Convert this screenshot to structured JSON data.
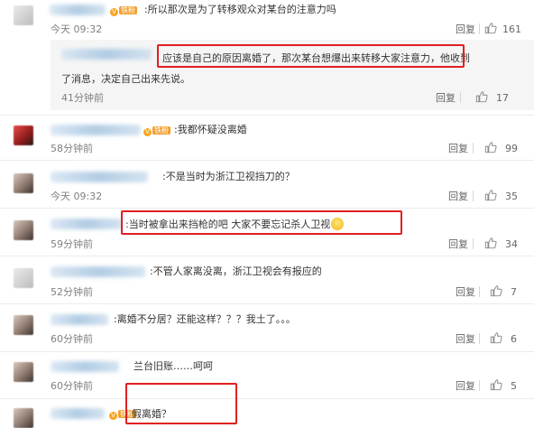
{
  "comments": [
    {
      "text": ":所以那次是为了转移观众对某台的注意力吗",
      "time": "今天 09:32",
      "reply": "回复",
      "likes": "161",
      "badge": "铁粉"
    },
    {
      "text_line1": "应该是自己的原因离婚了，那次某台想爆出来转移大家注意力，他收到",
      "text_line2": "了消息，决定自己出来先说。",
      "time": "41分钟前",
      "reply": "回复",
      "likes": "17"
    },
    {
      "text": ":我都怀疑没离婚",
      "time": "58分钟前",
      "reply": "回复",
      "likes": "99",
      "badge": "铁粉"
    },
    {
      "text": ":不是当时为浙江卫视挡刀的？",
      "time": "今天 09:32",
      "reply": "回复",
      "likes": "35"
    },
    {
      "text": ":当时被拿出来挡枪的吧 大家不要忘记杀人卫视",
      "time": "59分钟前",
      "reply": "回复",
      "likes": "34"
    },
    {
      "text": ":不管人家离没离，浙江卫视会有报应的",
      "time": "52分钟前",
      "reply": "回复",
      "likes": "7"
    },
    {
      "text": ":离婚不分居？还能这样？？？我土了。。。",
      "time": "60分钟前",
      "reply": "回复",
      "likes": "6"
    },
    {
      "text": "兰台旧账……呵呵",
      "time": "60分钟前",
      "reply": "回复",
      "likes": "5"
    },
    {
      "text": "假离婚？",
      "badge": "铁粉"
    }
  ],
  "colors": {
    "highlight_box": "#e02020",
    "time_gray": "#808080",
    "text": "#333333",
    "badge_orange": "#f0a030"
  }
}
